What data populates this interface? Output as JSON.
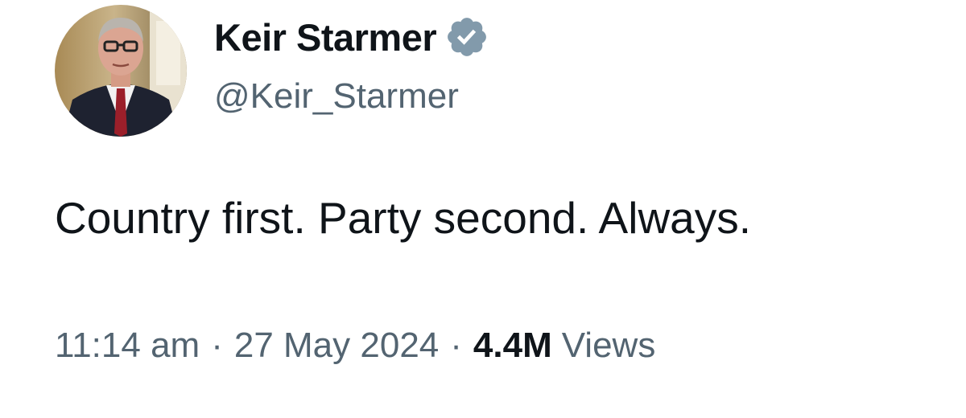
{
  "author": {
    "display_name": "Keir Starmer",
    "handle": "@Keir_Starmer",
    "verified_icon": "verified-badge-icon",
    "badge_color": "#829aab"
  },
  "tweet": {
    "text": "Country first. Party second. Always."
  },
  "meta": {
    "time": "11:14 am",
    "separator": "·",
    "date": "27 May 2024",
    "views_count": "4.4M",
    "views_label": "Views"
  },
  "colors": {
    "text_primary": "#0f1419",
    "text_secondary": "#536471",
    "background": "#ffffff"
  }
}
